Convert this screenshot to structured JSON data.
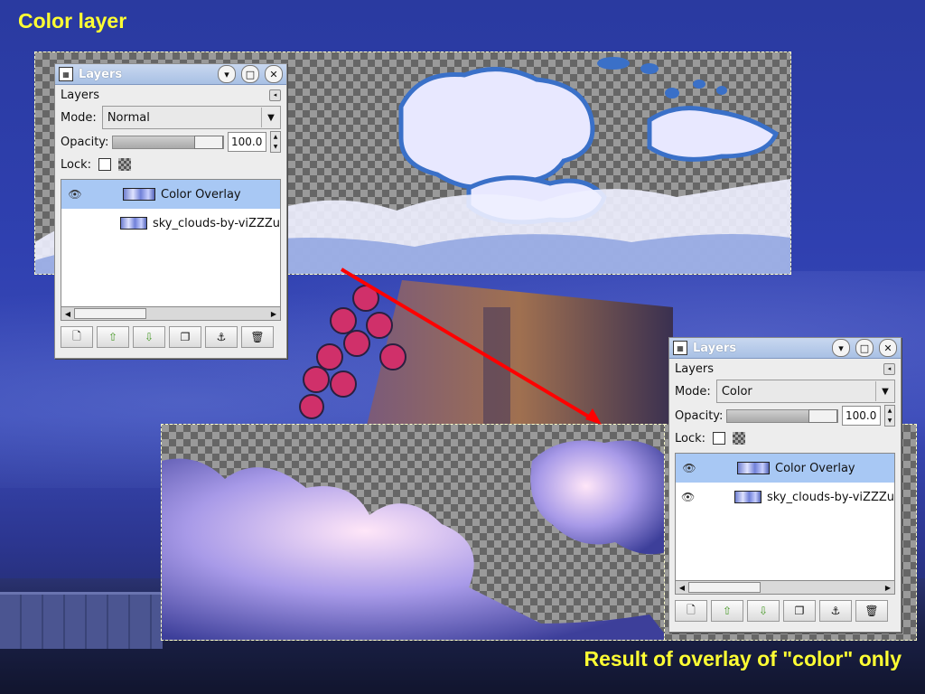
{
  "slide": {
    "title": "Color layer",
    "caption": "Result of overlay of \"color\" only"
  },
  "colors": {
    "title_text": "#ffff33",
    "arrow": "#ff0000",
    "selected_row": "#a8c8f4"
  },
  "docks": [
    {
      "title": "Layers",
      "tab_label": "Layers",
      "mode_label": "Mode:",
      "mode_value": "Normal",
      "opacity_label": "Opacity:",
      "opacity_value": "100.0",
      "lock_label": "Lock:",
      "layers": [
        {
          "name": "Color Overlay",
          "visible": true,
          "selected": true
        },
        {
          "name": "sky_clouds-by-viZZZu",
          "visible": false,
          "selected": false
        }
      ],
      "toolbar_icons": [
        "new-layer-icon",
        "raise-layer-icon",
        "lower-layer-icon",
        "duplicate-layer-icon",
        "anchor-layer-icon",
        "delete-layer-icon"
      ]
    },
    {
      "title": "Layers",
      "tab_label": "Layers",
      "mode_label": "Mode:",
      "mode_value": "Color",
      "opacity_label": "Opacity:",
      "opacity_value": "100.0",
      "lock_label": "Lock:",
      "layers": [
        {
          "name": "Color Overlay",
          "visible": true,
          "selected": true
        },
        {
          "name": "sky_clouds-by-viZZZu",
          "visible": true,
          "selected": false
        }
      ],
      "toolbar_icons": [
        "new-layer-icon",
        "raise-layer-icon",
        "lower-layer-icon",
        "duplicate-layer-icon",
        "anchor-layer-icon",
        "delete-layer-icon"
      ]
    }
  ]
}
